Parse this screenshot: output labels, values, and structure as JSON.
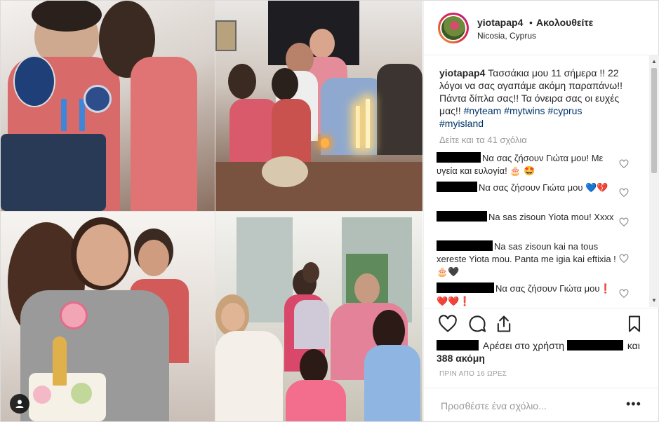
{
  "post": {
    "username": "yiotapap4",
    "separator": "•",
    "follow_label": "Ακολουθείτε",
    "location": "Nicosia, Cyprus",
    "caption_text": "Τασσάκια μου 11 σήμερα !! 22 λόγοι να σας αγαπάμε ακόμη παραπάνω!! Πάντα δίπλα σας!! Τα όνειρα σας οι ευχές μας!!",
    "hashtags": [
      "#nyteam",
      "#mytwins",
      "#cyprus",
      "#myisland"
    ],
    "view_all_comments": "Δείτε και τα 41 σχόλια",
    "comments": [
      {
        "text": "Να σας ζήσουν Γιώτα μου! Με υγεία και ευλογία! 🎂 🤩"
      },
      {
        "text": "Να σας ζήσουν Γιώτα μου 💙💔"
      },
      {
        "text": "Na sas zisoun Yiota mou! Xxxx"
      },
      {
        "text": "Na sas zisoun kai na tous xereste Yiota mou. Panta me igia kai eftixia !🎂🖤"
      },
      {
        "text": "Να σας ζήσουν Γιώτα μου❗❤️❤️❗"
      }
    ],
    "likes_prefix": "Αρέσει στο χρήστη",
    "likes_and": "και",
    "likes_more": "388 ακόμη",
    "timestamp": "ΠΡΙΝ ΑΠΟ 16 ΩΡΕΣ",
    "add_comment_placeholder": "Προσθέστε ένα σχόλιο...",
    "more_label": "•••"
  },
  "icons": {
    "heart": "heart-icon",
    "comment": "comment-icon",
    "share": "share-icon",
    "bookmark": "bookmark-icon",
    "tag": "person-tag-icon"
  },
  "colors": {
    "hashtag": "#003569",
    "muted": "#999999",
    "border": "#dbdbdb"
  }
}
